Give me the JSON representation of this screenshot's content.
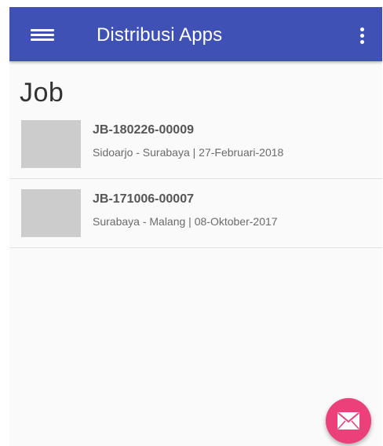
{
  "appbar": {
    "title": "Distribusi Apps",
    "menu_icon": "hamburger-menu-icon",
    "overflow_icon": "more-vert-icon",
    "color": "#3f51b5"
  },
  "page": {
    "heading": "Job"
  },
  "jobs": [
    {
      "id": "JB-180226-00009",
      "meta": "Sidoarjo - Surabaya | 27-Februari-2018"
    },
    {
      "id": "JB-171006-00007",
      "meta": "Surabaya - Malang | 08-Oktober-2017"
    }
  ],
  "fab": {
    "icon": "mail-icon",
    "color": "#ec407a"
  }
}
